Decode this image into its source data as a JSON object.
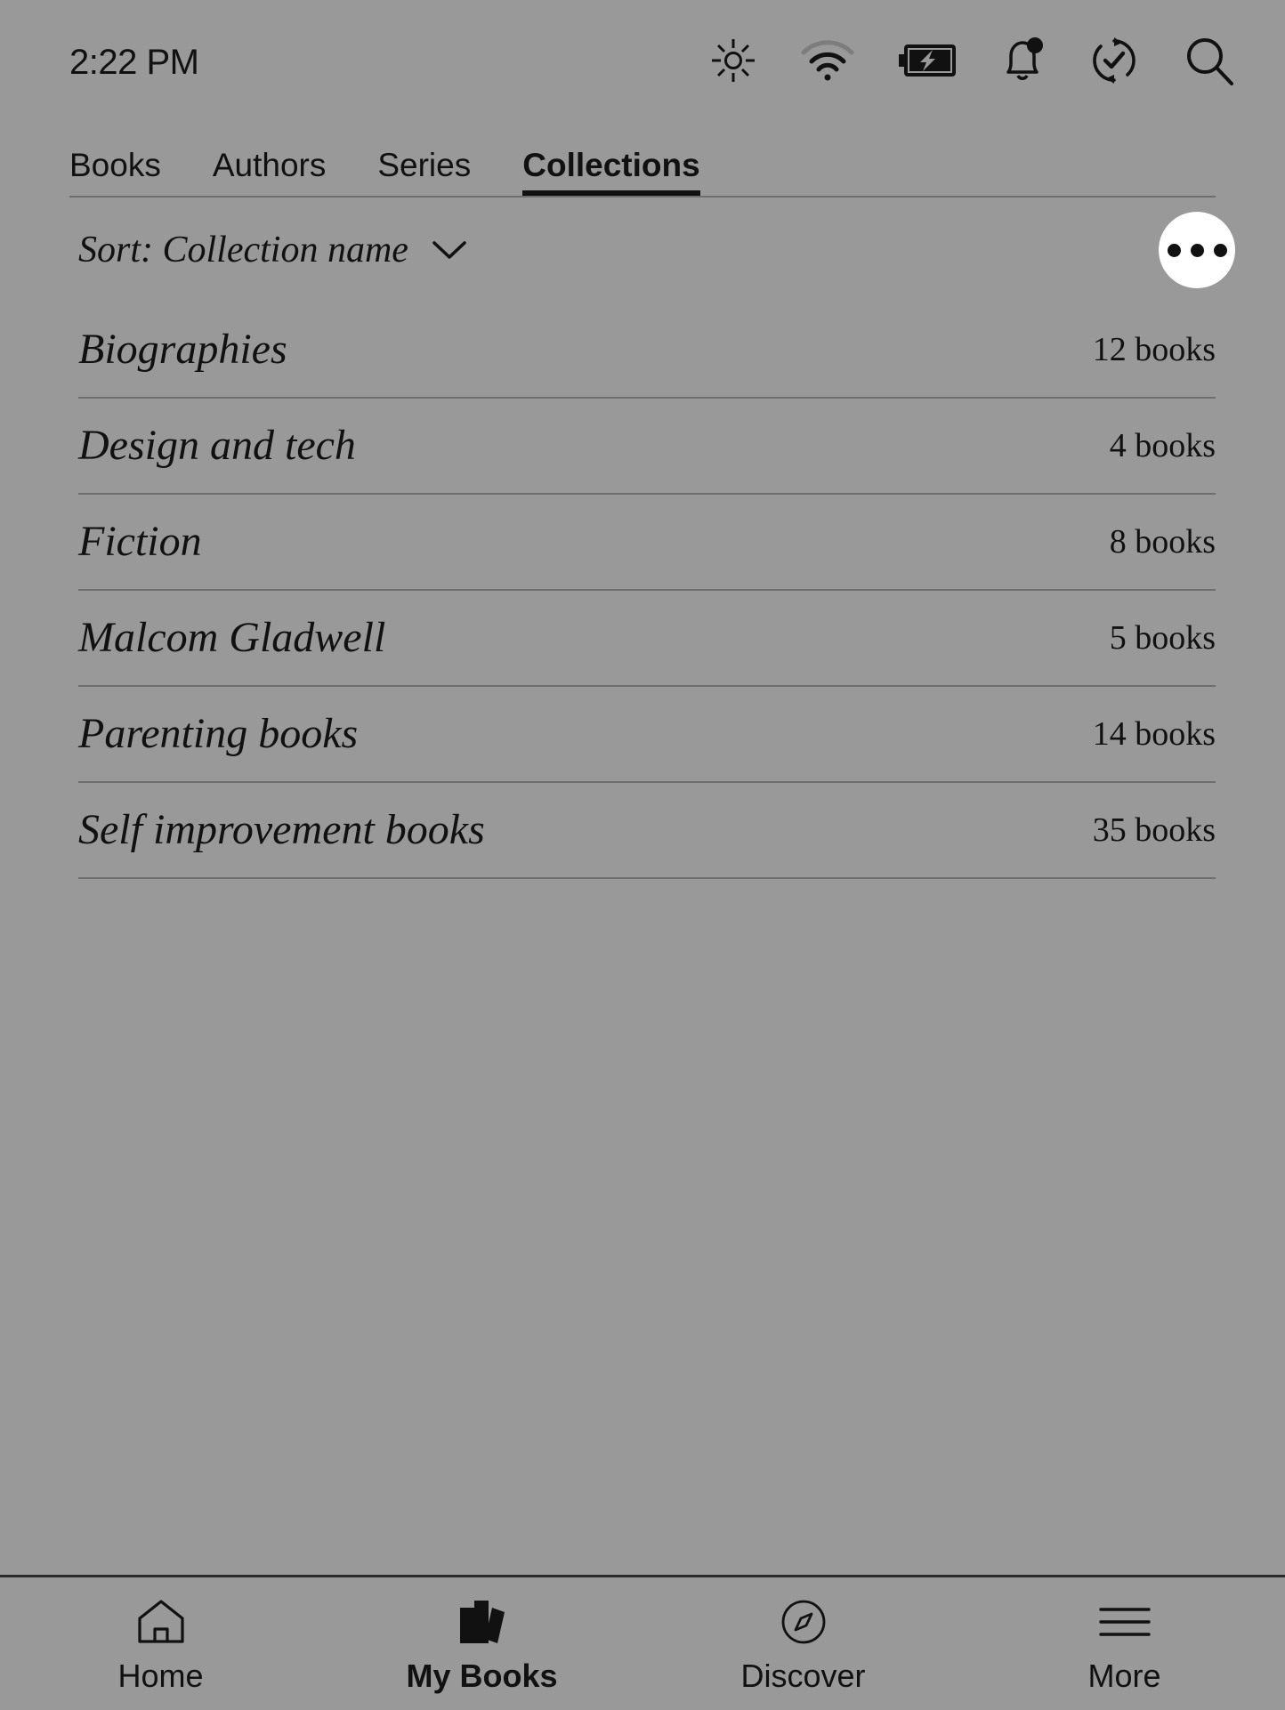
{
  "status_bar": {
    "time": "2:22 PM",
    "icons": [
      {
        "name": "brightness-icon",
        "label": "Brightness"
      },
      {
        "name": "wifi-icon",
        "label": "Wi-Fi"
      },
      {
        "name": "battery-charging-icon",
        "label": "Battery charging"
      },
      {
        "name": "notification-bell-icon",
        "label": "Notifications"
      },
      {
        "name": "sync-icon",
        "label": "Sync"
      },
      {
        "name": "search-icon",
        "label": "Search"
      }
    ]
  },
  "tabs": [
    {
      "label": "Books",
      "active": false
    },
    {
      "label": "Authors",
      "active": false
    },
    {
      "label": "Series",
      "active": false
    },
    {
      "label": "Collections",
      "active": true
    }
  ],
  "sort": {
    "label": "Sort: Collection name",
    "chevron_icon": "chevron-down-icon"
  },
  "overflow_button": {
    "icon": "more-horizontal-icon",
    "label": "More options"
  },
  "collections": [
    {
      "name": "Biographies",
      "count": "12 books"
    },
    {
      "name": "Design and tech",
      "count": "4 books"
    },
    {
      "name": "Fiction",
      "count": "8 books"
    },
    {
      "name": "Malcom Gladwell",
      "count": "5 books"
    },
    {
      "name": "Parenting books",
      "count": "14 books"
    },
    {
      "name": "Self improvement books",
      "count": "35 books"
    }
  ],
  "bottom_nav": [
    {
      "label": "Home",
      "icon": "home-icon",
      "active": false
    },
    {
      "label": "My Books",
      "icon": "books-icon",
      "active": true
    },
    {
      "label": "Discover",
      "icon": "compass-icon",
      "active": false
    },
    {
      "label": "More",
      "icon": "hamburger-menu-icon",
      "active": false
    }
  ],
  "colors": {
    "background": "#999999",
    "foreground": "#111111",
    "divider": "#6e6e6e",
    "fab_background": "#ffffff"
  }
}
